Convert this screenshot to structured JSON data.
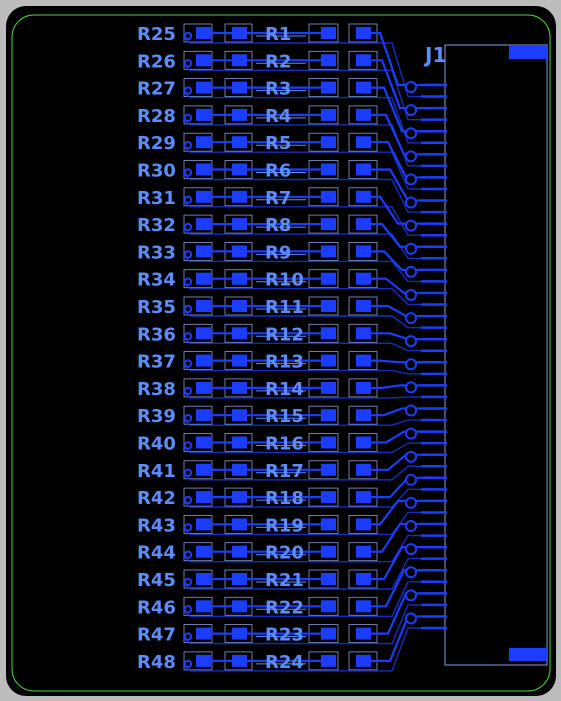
{
  "colors": {
    "background": "#000000",
    "frame": "#bcbcbc",
    "board_outline": "#4fd63a",
    "copper": "#1a3dff",
    "silkscreen": "#5d8cff",
    "courtyard": "#8a9bd8"
  },
  "connector": {
    "label": "J1",
    "pin_count": 48
  },
  "left_column_labels": [
    "R25",
    "R26",
    "R27",
    "R28",
    "R29",
    "R30",
    "R31",
    "R32",
    "R33",
    "R34",
    "R35",
    "R36",
    "R37",
    "R38",
    "R39",
    "R40",
    "R41",
    "R42",
    "R43",
    "R44",
    "R45",
    "R46",
    "R47",
    "R48"
  ],
  "right_column_labels": [
    "R1",
    "R2",
    "R3",
    "R4",
    "R5",
    "R6",
    "R7",
    "R8",
    "R9",
    "R10",
    "R11",
    "R12",
    "R13",
    "R14",
    "R15",
    "R16",
    "R17",
    "R18",
    "R19",
    "R20",
    "R21",
    "R22",
    "R23",
    "R24"
  ]
}
